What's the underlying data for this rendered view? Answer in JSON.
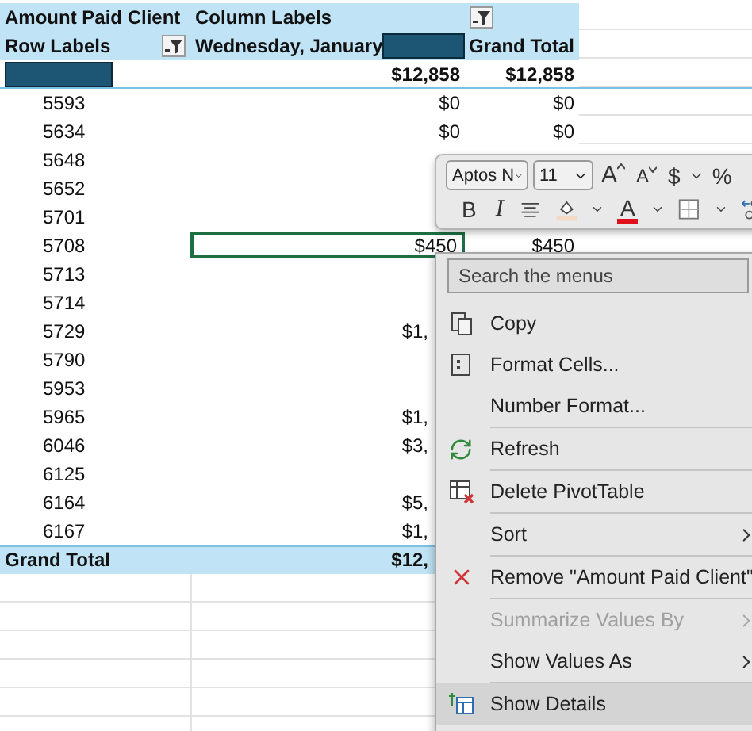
{
  "pivot": {
    "value_field": "Amount Paid Client",
    "column_labels": "Column Labels",
    "row_labels": "Row Labels",
    "column_header": {
      "text": "Wednesday, January",
      "redacted": true
    },
    "grand_total_header": "Grand Total",
    "summary_row": {
      "label_redacted": true,
      "value": "$12,858",
      "total": "$12,858"
    },
    "rows": [
      {
        "label": "5593",
        "value": "$0",
        "total": "$0",
        "selected": false
      },
      {
        "label": "5634",
        "value": "$0",
        "total": "$0",
        "selected": false
      },
      {
        "label": "5648",
        "selected": false
      },
      {
        "label": "5652",
        "selected": false
      },
      {
        "label": "5701",
        "selected": false
      },
      {
        "label": "5708",
        "value": "$450",
        "total": "$450",
        "selected": true
      },
      {
        "label": "5713",
        "selected": false
      },
      {
        "label": "5714",
        "selected": false
      },
      {
        "label": "5729",
        "value": "$1,",
        "selected": false
      },
      {
        "label": "5790",
        "selected": false
      },
      {
        "label": "5953",
        "selected": false
      },
      {
        "label": "5965",
        "value": "$1,",
        "selected": false
      },
      {
        "label": "6046",
        "value": "$3,",
        "selected": false
      },
      {
        "label": "6125",
        "selected": false
      },
      {
        "label": "6164",
        "value": "$5,",
        "selected": false
      },
      {
        "label": "6167",
        "value": "$1,",
        "selected": false
      }
    ],
    "grand_total": {
      "label": "Grand Total",
      "value": "$12,"
    }
  },
  "mini_toolbar": {
    "font": "Aptos N",
    "size": "11",
    "row_1": [
      {
        "kind": "grow",
        "text": "A"
      },
      {
        "kind": "shrink",
        "text": "A"
      },
      {
        "kind": "text",
        "text": "$"
      },
      {
        "kind": "caret"
      },
      {
        "kind": "text",
        "text": "%"
      }
    ],
    "row_2": [
      {
        "kind": "text",
        "text": "B"
      },
      {
        "kind": "italic",
        "text": "I"
      },
      {
        "kind": "align"
      },
      {
        "kind": "fill"
      },
      {
        "kind": "caret"
      },
      {
        "kind": "color",
        "text": "A"
      },
      {
        "kind": "caret"
      },
      {
        "kind": "borders"
      },
      {
        "kind": "caret"
      },
      {
        "kind": "decimal"
      }
    ]
  },
  "context_menu": {
    "search_placeholder": "Search the menus",
    "items": [
      {
        "kind": "copy",
        "label": "Copy",
        "disabled": false,
        "submenu": false,
        "highlighted": false
      },
      {
        "kind": "format",
        "label": "Format Cells...",
        "disabled": false,
        "submenu": false,
        "highlighted": false
      },
      {
        "kind": "plain",
        "label": "Number Format...",
        "disabled": false,
        "submenu": false,
        "highlighted": false
      },
      {
        "kind": "separator"
      },
      {
        "kind": "refresh",
        "label": "Refresh",
        "disabled": false,
        "submenu": false,
        "highlighted": false
      },
      {
        "kind": "separator"
      },
      {
        "kind": "delete",
        "label": "Delete PivotTable",
        "disabled": false,
        "submenu": false,
        "highlighted": false
      },
      {
        "kind": "separator"
      },
      {
        "kind": "plain",
        "label": "Sort",
        "disabled": false,
        "submenu": true,
        "highlighted": false
      },
      {
        "kind": "separator"
      },
      {
        "kind": "remove",
        "label": "Remove \"Amount Paid Client\"",
        "disabled": false,
        "submenu": false,
        "highlighted": false
      },
      {
        "kind": "separator"
      },
      {
        "kind": "plain",
        "label": "Summarize Values By",
        "disabled": true,
        "submenu": true,
        "highlighted": false
      },
      {
        "kind": "plain",
        "label": "Show Values As",
        "disabled": false,
        "submenu": true,
        "highlighted": false
      },
      {
        "kind": "separator"
      },
      {
        "kind": "details",
        "label": "Show Details",
        "disabled": false,
        "submenu": false,
        "highlighted": true
      }
    ]
  }
}
